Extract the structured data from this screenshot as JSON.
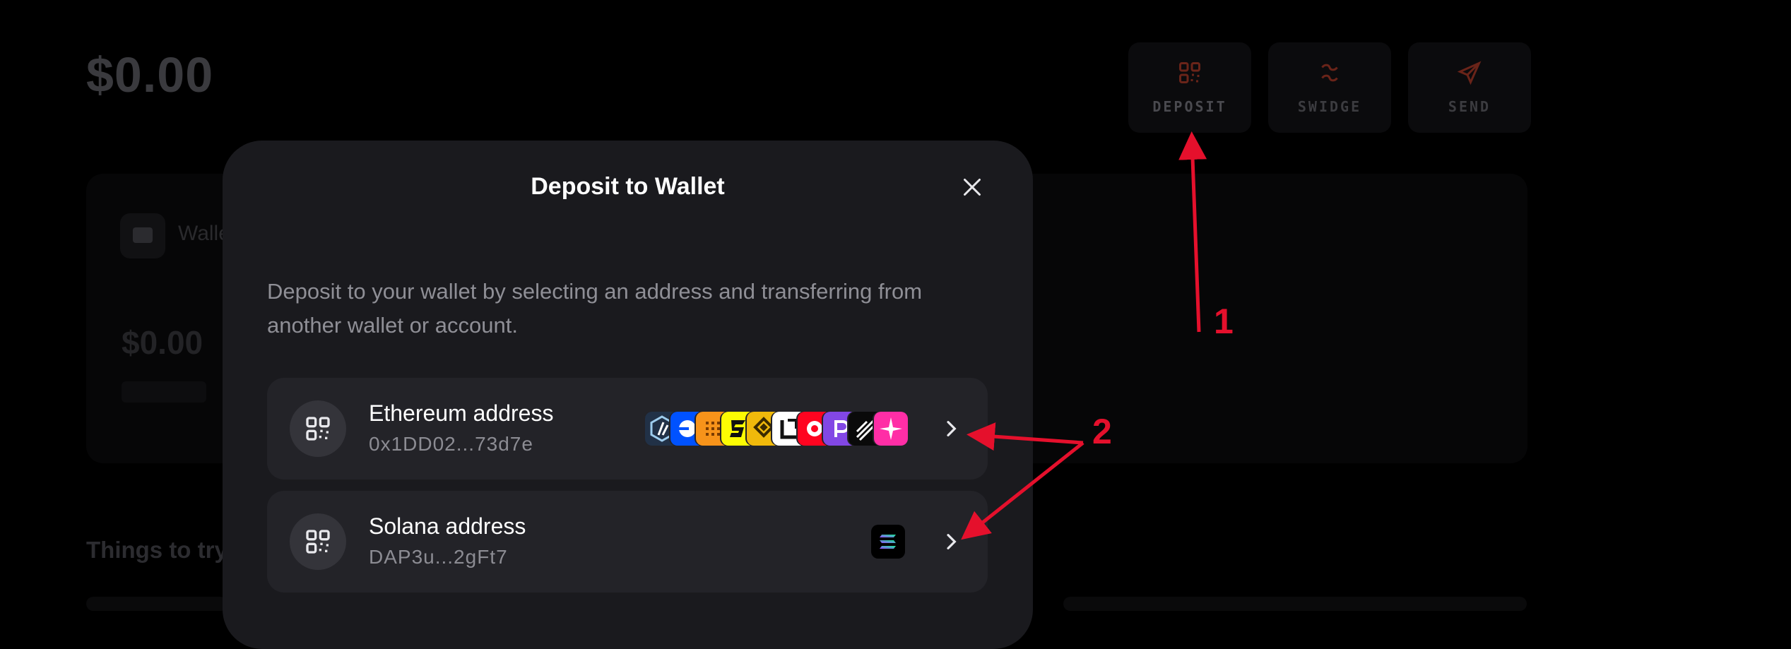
{
  "background": {
    "balance": "$0.00",
    "actions": [
      {
        "label": "DEPOSIT",
        "icon": "qr-code-icon"
      },
      {
        "label": "SWIDGE",
        "icon": "swidge-icon"
      },
      {
        "label": "SEND",
        "icon": "paper-plane-icon"
      }
    ],
    "wallet_label": "Walle",
    "card_amount": "$0.00",
    "things_title": "Things to try"
  },
  "modal": {
    "title": "Deposit to Wallet",
    "description": "Deposit to your wallet by selecting an address and transferring from another wallet or account.",
    "addresses": [
      {
        "name": "Ethereum address",
        "value": "0x1DD02...73d7e",
        "icon": "qr-code-icon",
        "chain_icons": [
          "arbitrum-icon",
          "base-icon",
          "bnb-icon",
          "blast-icon",
          "bnb-smart-icon",
          "linea-icon",
          "optimism-icon",
          "polygon-icon",
          "zora-icon",
          "degen-icon"
        ]
      },
      {
        "name": "Solana address",
        "value": "DAP3u...2gFt7",
        "icon": "qr-code-icon",
        "chain_icons": [
          "solana-icon"
        ]
      }
    ]
  },
  "annotations": {
    "label_1": "1",
    "label_2": "2",
    "color": "#e5102c"
  },
  "colors": {
    "modal_bg": "#1a1a1e",
    "row_bg": "#232328",
    "accent_deposit": "#7a2a1f"
  }
}
